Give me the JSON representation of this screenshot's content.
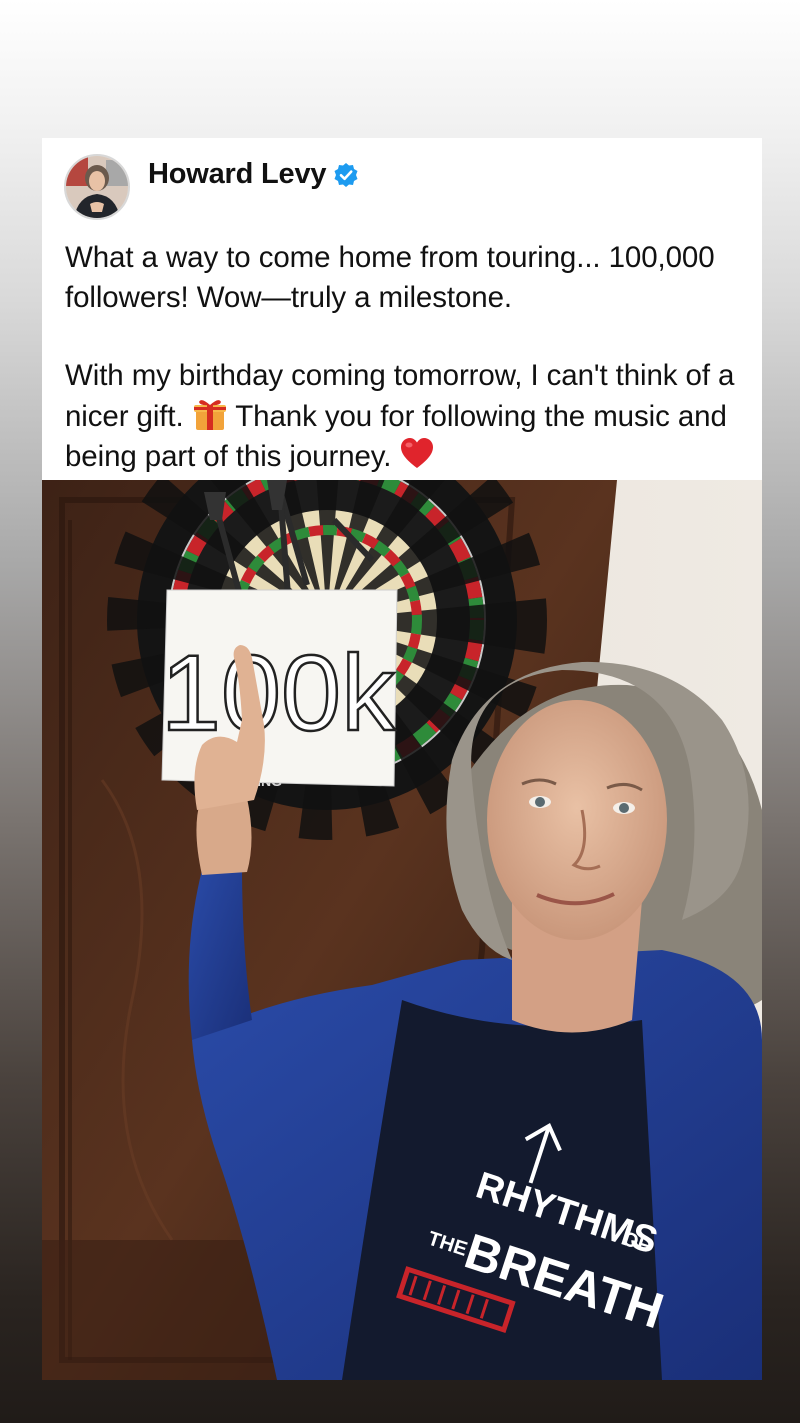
{
  "post": {
    "author": "Howard Levy",
    "verified": true,
    "avatar_icon": "profile-photo",
    "verified_icon": "verified-badge-icon",
    "text_paragraph_1": "What a way to come home from touring... 100,000 followers! Wow—truly a milestone.",
    "text_paragraph_2_part_1": "With my birthday coming tomorrow, I can't think of a nicer gift. ",
    "text_paragraph_2_part_2": " Thank you for following the music and being part of this journey. ",
    "emoji_1": "gift-icon",
    "emoji_2": "red-heart-icon"
  },
  "photo": {
    "sign_text": "100k",
    "shirt_line_1": "RHYTHMS",
    "shirt_line_1_small": "OF",
    "shirt_line_2_prefix": "THE",
    "shirt_line_2": "BREATH",
    "dartboard_rim_text": "KING"
  },
  "colors": {
    "verified_blue": "#1d9bf0",
    "text": "#111111",
    "shirt_blue": "#1f3a8a",
    "tshirt_navy": "#131a2e",
    "door_brown": "#4b2a1a"
  }
}
